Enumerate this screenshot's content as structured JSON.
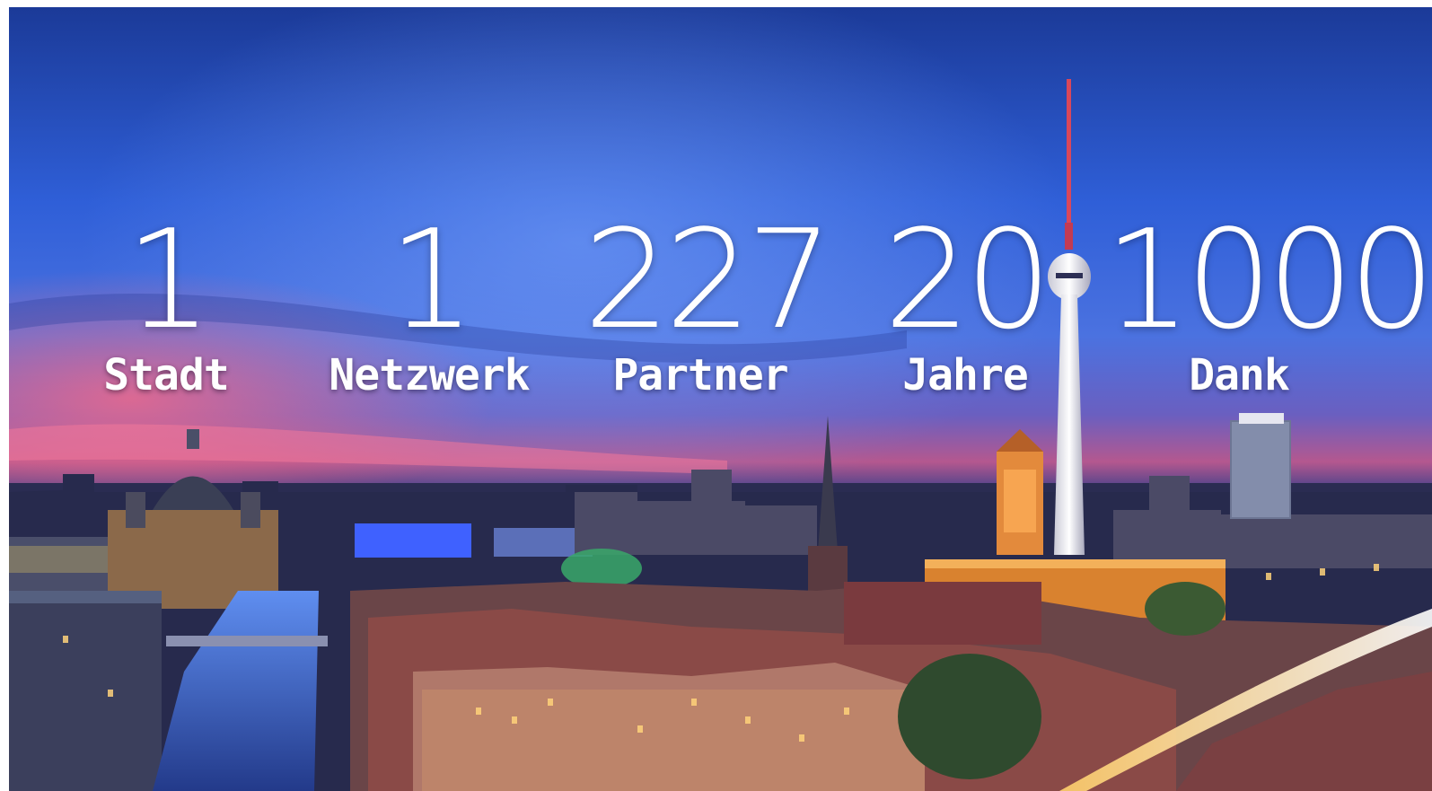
{
  "stats": [
    {
      "number": "1",
      "label": "Stadt"
    },
    {
      "number": "1",
      "label": "Netzwerk"
    },
    {
      "number": "227",
      "label": "Partner"
    },
    {
      "number": "20",
      "label": "Jahre"
    },
    {
      "number": "1000",
      "label": "Dank"
    }
  ],
  "colors": {
    "sky_top": "#1f3f9e",
    "sky_mid": "#3d6fe6",
    "sunset_pink": "#e4577e",
    "city_dark": "#1d2240",
    "text": "#ffffff"
  }
}
